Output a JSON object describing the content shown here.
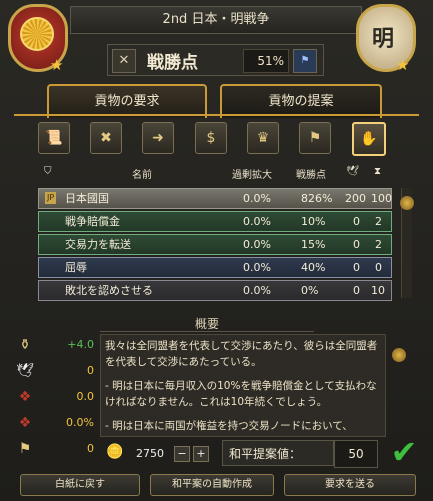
{
  "header": {
    "title": "2nd 日本・明戦争",
    "score_label": "戦勝点",
    "score_value": "51%",
    "right_seal_char": "明"
  },
  "tabs": [
    {
      "label": "貢物の要求",
      "selected": true
    },
    {
      "label": "貢物の提案",
      "selected": false
    }
  ],
  "toolbar_icons": [
    "claim-scroll-icon",
    "cancel-scroll-icon",
    "transfer-scroll-icon",
    "war-reparations-icon",
    "crown-flags-icon",
    "broken-flag-icon",
    "humiliate-icon"
  ],
  "table": {
    "columns": [
      "名前",
      "過剰拡大",
      "戦勝点"
    ],
    "rows": [
      {
        "name": "日本國国",
        "overextension": "0.0%",
        "warscore": "826%",
        "c1": "200",
        "c2": "100",
        "tag": "JP"
      },
      {
        "name": "戦争賠償金",
        "overextension": "0.0%",
        "warscore": "10%",
        "c1": "0",
        "c2": "2"
      },
      {
        "name": "交易力を転送",
        "overextension": "0.0%",
        "warscore": "15%",
        "c1": "0",
        "c2": "2"
      },
      {
        "name": "屈辱",
        "overextension": "0.0%",
        "warscore": "40%",
        "c1": "0",
        "c2": "0"
      },
      {
        "name": "敗北を認めさせる",
        "overextension": "0.0%",
        "warscore": "0%",
        "c1": "0",
        "c2": "10"
      }
    ]
  },
  "summary": {
    "heading": "概要",
    "side_values": [
      "+4.0",
      "0",
      "0.0",
      "0.0%",
      "0"
    ],
    "paragraphs": [
      "我々は全同盟者を代表して交渉にあたり、彼らは全同盟者を代表して交渉にあたっている。",
      "- 明は日本に毎月収入の10%を戦争賠償金として支払わなければなりません。これは10年続くでしょう。",
      "- 明は日本に両国が権益を持つ交易ノードにおいて、"
    ]
  },
  "bottom": {
    "money": "2750",
    "minus": "−",
    "plus": "+",
    "peace_label": "和平提案値：",
    "peace_value": "50",
    "buttons": [
      "白紙に戻す",
      "和平案の自動作成",
      "要求を送る"
    ]
  },
  "colors": {
    "accent_gold": "#c99a36",
    "green_check": "#3fbf3f"
  }
}
